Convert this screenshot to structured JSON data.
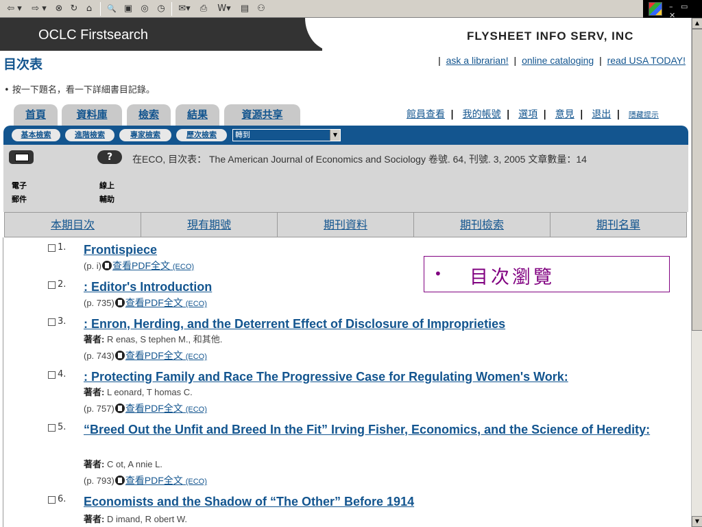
{
  "toolbar": {
    "back": "⇦ ▾",
    "forward": "⇨ ▾",
    "stop": "⊗",
    "refresh": "↻",
    "home": "⌂",
    "search": "🔍",
    "favorites": "▣",
    "media": "◎",
    "history": "◷",
    "mail": "✉▾",
    "print": "⎙",
    "edit": "W▾",
    "discuss": "▤",
    "messenger": "⚇"
  },
  "window_controls": "– ▭ ✕",
  "header": {
    "app_title": "OCLC Firstsearch",
    "org_name": "FLYSHEET INFO SERV, INC"
  },
  "page_title": "目次表",
  "top_links": [
    "ask a librarian!",
    "online cataloging",
    "read USA TODAY!"
  ],
  "instruction": "按一下題名，看一下詳細書目記錄。",
  "tabs": [
    "首頁",
    "資料庫",
    "檢索",
    "結果",
    "資源共享"
  ],
  "right_links": [
    "館員查看",
    "我的帳號",
    "選項",
    "意見",
    "退出",
    "隱藏提示"
  ],
  "search_buttons": [
    "基本檢索",
    "進階檢索",
    "專家檢索",
    "歷次檢索"
  ],
  "goto_select": "轉到",
  "info_panel": {
    "email_label": "電子郵件",
    "help_label": "線上輔助",
    "issue_info": "在ECO, 目次表： The American Journal of Economics and Sociology 卷號. 64, 刊號. 3, 2005 文章數量：14"
  },
  "nav_row": [
    "本期目次",
    "現有期號",
    "期刊資料",
    "期刊檢索",
    "期刊名單"
  ],
  "callout": "目次瀏覽",
  "articles": [
    {
      "num": "1.",
      "title": "Frontispiece",
      "author_label": "",
      "authors": "",
      "page": "(p. i)",
      "pdf": "查看PDF全文",
      "src": "(ECO)"
    },
    {
      "num": "2.",
      "title": ": Editor's Introduction",
      "author_label": "",
      "authors": "",
      "page": "(p. 735)",
      "pdf": "查看PDF全文",
      "src": "(ECO)"
    },
    {
      "num": "3.",
      "title": ": Enron, Herding, and the Deterrent Effect of Disclosure of Improprieties",
      "author_label": "著者:",
      "authors": "R enas, S tephen M., 和其他.",
      "page": "(p. 743)",
      "pdf": "查看PDF全文",
      "src": "(ECO)"
    },
    {
      "num": "4.",
      "title": ": Protecting Family and Race The Progressive Case for Regulating Women's Work:",
      "author_label": "著者:",
      "authors": "L eonard, T homas C.",
      "page": "(p. 757)",
      "pdf": "查看PDF全文",
      "src": "(ECO)"
    },
    {
      "num": "5.",
      "title": "“Breed Out the Unfit and Breed In the Fit” Irving Fisher, Economics, and the Science of Heredity:",
      "author_label": "著者:",
      "authors": "C ot, A nnie L.",
      "page": "(p. 793)",
      "pdf": "查看PDF全文",
      "src": "(ECO)"
    },
    {
      "num": "6.",
      "title": "Economists and the Shadow of “The Other” Before 1914",
      "author_label": "著者:",
      "authors": "D imand, R obert W.",
      "page": "",
      "pdf": "",
      "src": ""
    }
  ]
}
